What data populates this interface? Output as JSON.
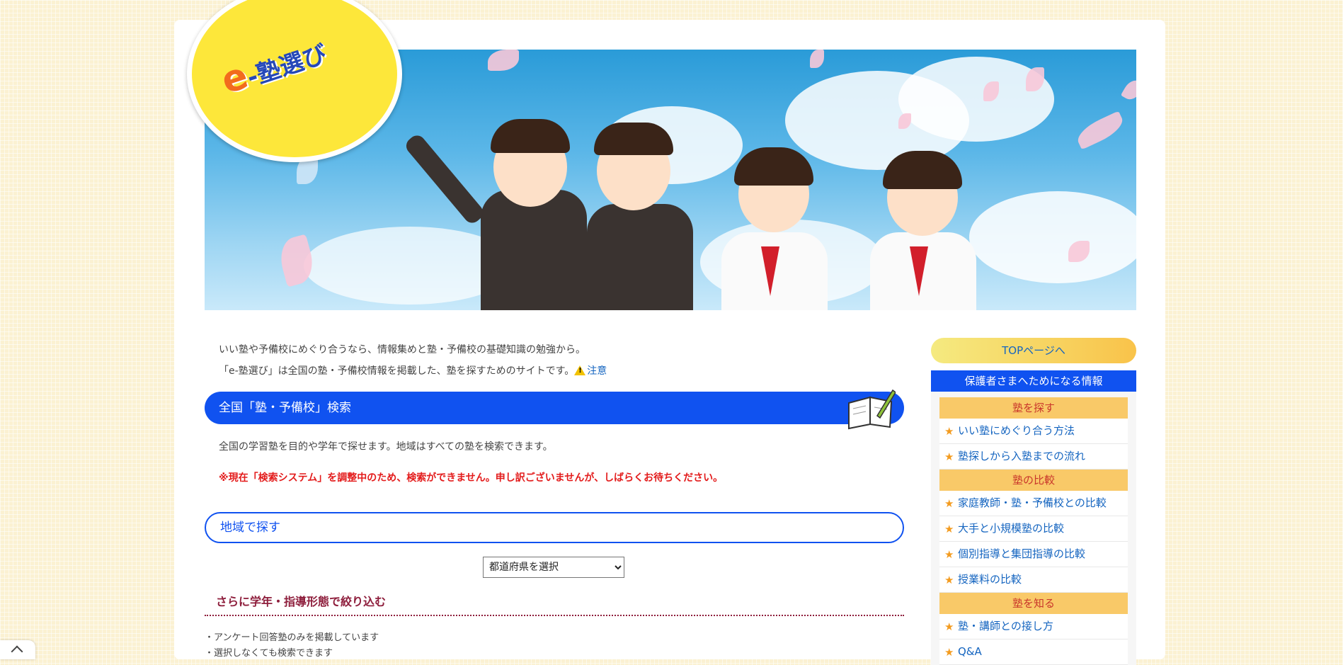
{
  "logo": {
    "text_e": "e",
    "text_rest": "-塾選び"
  },
  "intro": {
    "line1": "いい塾や予備校にめぐり合うなら、情報集めと塾・予備校の基礎知識の勉強から。",
    "line2": "「e-塾選び」は全国の塾・予備校情報を掲載した、塾を探すためのサイトです。",
    "notice_link": "注意"
  },
  "search": {
    "title": "全国「塾・予備校」検索",
    "description": "全国の学習塾を目的や学年で探せます。地域はすべての塾を検索できます。",
    "alert": "※現在「検索システム」を調整中のため、検索ができません。申し訳ございませんが、しばらくお待ちください。",
    "region_title": "地域で探す",
    "prefecture_select": "都道府県を選択",
    "filter_title": "さらに学年・指導形態で絞り込む",
    "notes": [
      "・アンケート回答塾のみを掲載しています",
      "・選択しなくても検索できます"
    ]
  },
  "sidebar": {
    "top_button": "TOPページへ",
    "header": "保護者さまへためになる情報",
    "categories": [
      {
        "title": "塾を探す",
        "links": [
          "いい塾にめぐり合う方法",
          "塾探しから入塾までの流れ"
        ]
      },
      {
        "title": "塾の比較",
        "links": [
          "家庭教師・塾・予備校との比較",
          "大手と小規模塾の比較",
          "個別指導と集団指導の比較",
          "授業料の比較"
        ]
      },
      {
        "title": "塾を知る",
        "links": [
          "塾・講師との接し方",
          "Q&A"
        ]
      }
    ]
  },
  "colors": {
    "primary_blue": "#1052f0",
    "alert_red": "#e31b1b",
    "category_orange": "#f9c968",
    "logo_yellow": "#fde73a"
  },
  "icons": {
    "warning": "warning-icon",
    "book": "notebook-pen-icon",
    "star": "star-icon",
    "scroll_up": "chevron-up-icon"
  }
}
